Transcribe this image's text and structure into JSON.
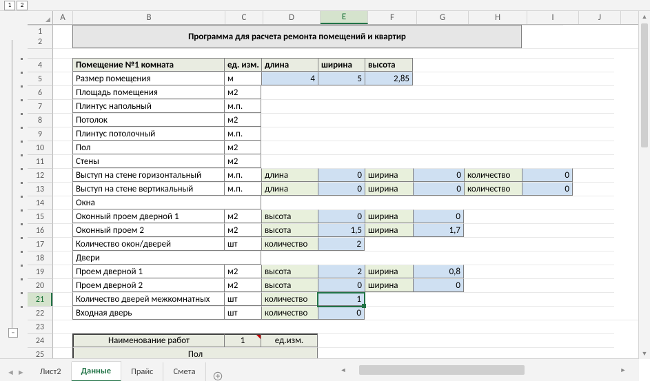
{
  "outline": {
    "level1": "1",
    "level2": "2",
    "minus": "−"
  },
  "columns": [
    "A",
    "B",
    "C",
    "D",
    "E",
    "F",
    "G",
    "H",
    "I",
    "J"
  ],
  "rows_visible": [
    "1",
    "2",
    "4",
    "5",
    "6",
    "7",
    "8",
    "9",
    "10",
    "11",
    "12",
    "13",
    "14",
    "15",
    "16",
    "17",
    "18",
    "19",
    "20",
    "21",
    "22",
    "23",
    "24",
    "25"
  ],
  "title": "Программа для расчета ремонта помещений и квартир",
  "headerRow": {
    "room": "Помещение №1 комната",
    "unit": "ед. изм.",
    "length": "длина",
    "width": "ширина",
    "height": "высота"
  },
  "r5": {
    "label": "Размер помещения",
    "unit": "м",
    "d": "4",
    "e": "5",
    "f": "2,85"
  },
  "r6": {
    "label": "Площадь помещения",
    "unit": "м2"
  },
  "r7": {
    "label": "Плинтус напольный",
    "unit": "м.п."
  },
  "r8": {
    "label": "Потолок",
    "unit": "м2"
  },
  "r9": {
    "label": "Плинтус потолочный",
    "unit": "м.п."
  },
  "r10": {
    "label": "Пол",
    "unit": "м2"
  },
  "r11": {
    "label": "Стены",
    "unit": "м2"
  },
  "r12": {
    "label": "Выступ на стене горизонтальный",
    "unit": "м.п.",
    "d": "длина",
    "e": "0",
    "f": "ширина",
    "g": "0",
    "h": "количество",
    "i": "0"
  },
  "r13": {
    "label": "Выступ на стене вертикальный",
    "unit": "м.п.",
    "d": "длина",
    "e": "0",
    "f": "ширина",
    "g": "0",
    "h": "количество",
    "i": "0"
  },
  "r14": {
    "label": "Окна"
  },
  "r15": {
    "label": "Оконный проем дверной 1",
    "unit": "м2",
    "d": "высота",
    "e": "0",
    "f": "ширина",
    "g": "0"
  },
  "r16": {
    "label": "Оконный проем 2",
    "unit": "м2",
    "d": "высота",
    "e": "1,5",
    "f": "ширина",
    "g": "1,7"
  },
  "r17": {
    "label": "Количество окон/дверей",
    "unit": "шт",
    "d": "количество",
    "e": "2"
  },
  "r18": {
    "label": "Двери"
  },
  "r19": {
    "label": "Проем дверной 1",
    "unit": "м2",
    "d": "высота",
    "e": "2",
    "f": "ширина",
    "g": "0,8"
  },
  "r20": {
    "label": "Проем дверной 2",
    "unit": "м2",
    "d": "высота",
    "e": "0",
    "f": "ширина",
    "g": "0"
  },
  "r21": {
    "label": "Количество дверей межкомнатных",
    "unit": "шт",
    "d": "количество",
    "e": "1"
  },
  "r22": {
    "label": "Входная дверь",
    "unit": "шт",
    "d": "количество",
    "e": "0"
  },
  "r24": {
    "label": "Наименование работ",
    "c": "1",
    "d": "ед.изм."
  },
  "r25": {
    "label": "Пол"
  },
  "tabs": {
    "t1": "Лист2",
    "t2": "Данные",
    "t3": "Прайс",
    "t4": "Смета"
  },
  "active_cell": "E21"
}
